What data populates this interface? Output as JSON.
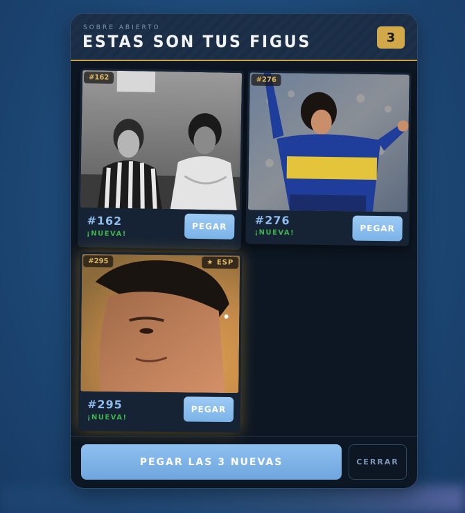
{
  "header": {
    "subtitle": "SOBRE ABIERTO",
    "title": "ESTAS SON TUS FIGUS",
    "count": "3"
  },
  "cards": [
    {
      "tag": "#162",
      "number": "#162",
      "status": "¡NUEVA!",
      "button_label": "PEGAR",
      "photo": "bw-photo-two-people"
    },
    {
      "tag": "#276",
      "number": "#276",
      "status": "¡NUEVA!",
      "button_label": "PEGAR",
      "photo": "footballer-blue-gold-shirt-celebrating"
    },
    {
      "tag": "#295",
      "special_tag": "★ ESP",
      "number": "#295",
      "status": "¡NUEVA!",
      "button_label": "PEGAR",
      "photo": "closeup-face-golden-light"
    }
  ],
  "footer": {
    "main_button": "PEGAR LAS 3 NUEVAS",
    "close_button": "CERRAR"
  },
  "colors": {
    "accent_gold": "#d1a84a",
    "button_blue": "#7bb3e8",
    "status_green": "#3fb34f",
    "number_blue": "#8fbcee",
    "modal_bg": "#0d1723"
  }
}
